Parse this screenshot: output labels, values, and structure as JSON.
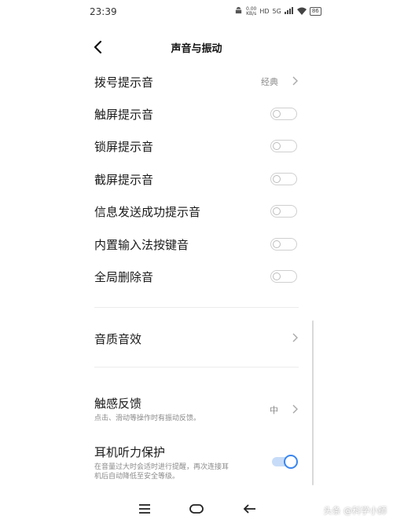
{
  "status_bar": {
    "time": "23:39",
    "network_speed_top": "0.00",
    "network_speed_bottom": "KB/s",
    "hd_label": "HD",
    "signal_label": "5G",
    "battery": "86"
  },
  "header": {
    "title": "声音与振动"
  },
  "rows": [
    {
      "label": "拨号提示音",
      "value": "经典"
    },
    {
      "label": "触屏提示音",
      "toggle": false
    },
    {
      "label": "锁屏提示音",
      "toggle": false
    },
    {
      "label": "截屏提示音",
      "toggle": false
    },
    {
      "label": "信息发送成功提示音",
      "toggle": false
    },
    {
      "label": "内置输入法按键音",
      "toggle": false
    },
    {
      "label": "全局删除音",
      "toggle": false
    }
  ],
  "sound_quality": {
    "label": "音质音效"
  },
  "haptic": {
    "label": "触感反馈",
    "desc": "点击、滑动等操作时有振动反馈。",
    "value": "中"
  },
  "hearing": {
    "label": "耳机听力保护",
    "desc_line1": "在音量过大时会适时进行提醒，再次连接耳",
    "desc_line2": "机后自动降低至安全等级。",
    "toggle": true
  },
  "watermark": "头条 @科学小師",
  "colors": {
    "accent": "#3a86f0",
    "toggle_off": "#cfcfcf",
    "secondary_text": "#8a8a8a"
  }
}
